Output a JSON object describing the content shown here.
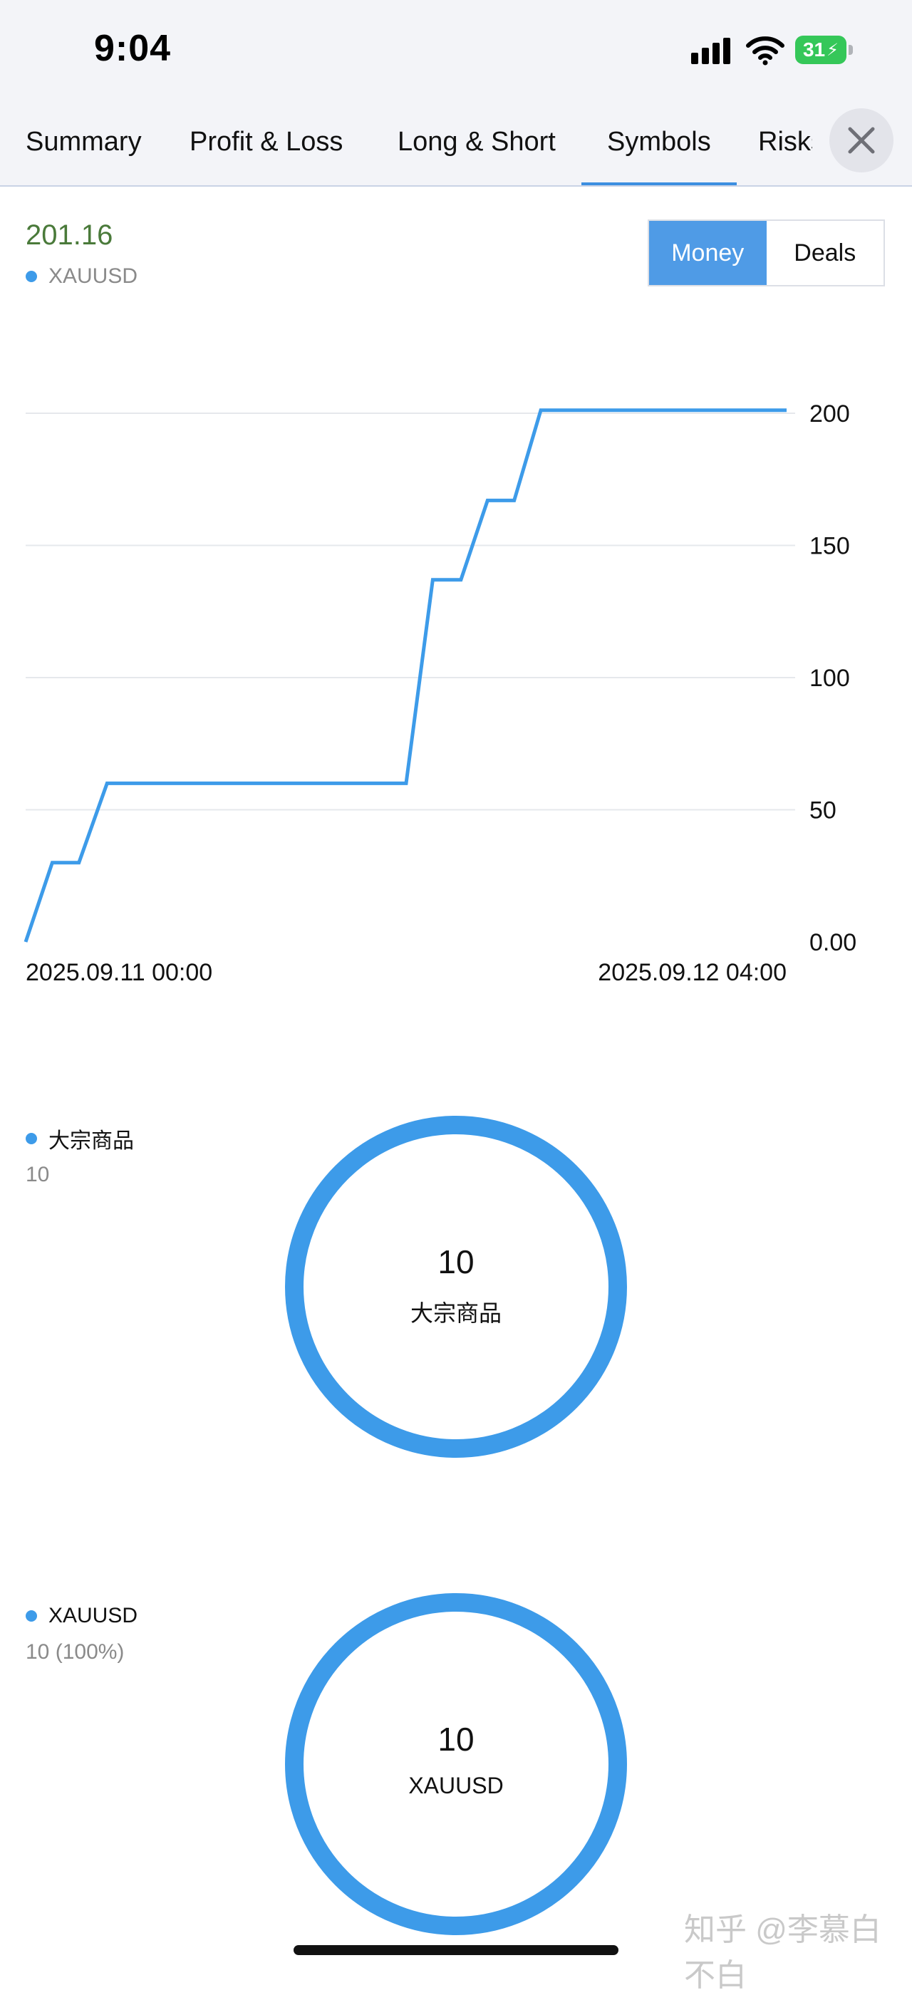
{
  "status_bar": {
    "time": "9:04",
    "battery": "31",
    "icons": [
      "signal-icon",
      "wifi-icon",
      "battery-charging-icon"
    ]
  },
  "tabs": [
    {
      "label": "Summary",
      "active": false
    },
    {
      "label": "Profit & Loss",
      "active": false
    },
    {
      "label": "Long & Short",
      "active": false
    },
    {
      "label": "Symbols",
      "active": true
    },
    {
      "label": "Risks",
      "active": false
    }
  ],
  "close_icon": "close-icon",
  "header": {
    "value": "201.16",
    "legend_label": "XAUUSD",
    "toggle": {
      "money": "Money",
      "deals": "Deals",
      "selected": "Money"
    }
  },
  "colors": {
    "series": "#3d9be9",
    "accent": "#4f9be6",
    "value_green": "#4a7a3a"
  },
  "chart_data": [
    {
      "type": "line",
      "series": [
        {
          "name": "XAUUSD",
          "x": [
            0.0,
            0.035,
            0.07,
            0.107,
            0.5,
            0.535,
            0.572,
            0.607,
            0.642,
            0.677,
            1.0
          ],
          "y": [
            0,
            30,
            30,
            60,
            60,
            137,
            137,
            167,
            167,
            201.16,
            201.16
          ],
          "step": true
        }
      ],
      "x_tick_labels": [
        "2025.09.11 00:00",
        "2025.09.12 04:00"
      ],
      "y_ticks": [
        0,
        50,
        100,
        150,
        200
      ],
      "y_tick_labels": [
        "0.00",
        "50",
        "100",
        "150",
        "200"
      ],
      "ylim": [
        0,
        200
      ],
      "grid": true,
      "y_axis_side": "right"
    },
    {
      "type": "pie",
      "style": "donut",
      "labels": [
        "大宗商品"
      ],
      "values": [
        10
      ],
      "center_value": "10",
      "center_label": "大宗商品",
      "legend": [
        {
          "label": "大宗商品",
          "sub": "10"
        }
      ]
    },
    {
      "type": "pie",
      "style": "donut",
      "labels": [
        "XAUUSD"
      ],
      "values": [
        10
      ],
      "center_value": "10",
      "center_label": "XAUUSD",
      "legend": [
        {
          "label": "XAUUSD",
          "sub": "10 (100%)"
        }
      ]
    }
  ],
  "watermark": "知乎 @李慕白不白"
}
